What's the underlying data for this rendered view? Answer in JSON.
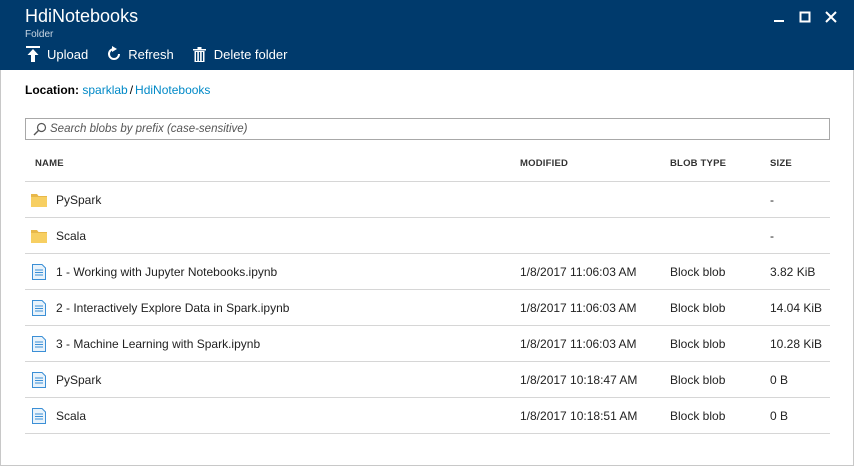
{
  "header": {
    "title": "HdiNotebooks",
    "subtitle": "Folder",
    "bg_color": "#003a6c"
  },
  "window_controls": [
    {
      "name": "minimize-icon"
    },
    {
      "name": "maximize-icon"
    },
    {
      "name": "close-icon"
    }
  ],
  "toolbar": {
    "upload_label": "Upload",
    "refresh_label": "Refresh",
    "delete_label": "Delete folder"
  },
  "location": {
    "label": "Location:",
    "path": [
      "sparklab",
      "HdiNotebooks"
    ],
    "separator": "/",
    "link_color": "#0089c7"
  },
  "search": {
    "placeholder": "Search blobs by prefix (case-sensitive)",
    "value": ""
  },
  "table": {
    "columns": [
      "NAME",
      "MODIFIED",
      "BLOB TYPE",
      "SIZE"
    ],
    "rows": [
      {
        "icon": "folder-icon",
        "name": "PySpark",
        "modified": "",
        "type": "",
        "size": "-"
      },
      {
        "icon": "folder-icon",
        "name": "Scala",
        "modified": "",
        "type": "",
        "size": "-"
      },
      {
        "icon": "file-icon",
        "name": "1 - Working with Jupyter Notebooks.ipynb",
        "modified": "1/8/2017 11:06:03 AM",
        "type": "Block blob",
        "size": "3.82 KiB"
      },
      {
        "icon": "file-icon",
        "name": "2 - Interactively Explore Data in Spark.ipynb",
        "modified": "1/8/2017 11:06:03 AM",
        "type": "Block blob",
        "size": "14.04 KiB"
      },
      {
        "icon": "file-icon",
        "name": "3 - Machine Learning with Spark.ipynb",
        "modified": "1/8/2017 11:06:03 AM",
        "type": "Block blob",
        "size": "10.28 KiB"
      },
      {
        "icon": "file-icon",
        "name": "PySpark",
        "modified": "1/8/2017 10:18:47 AM",
        "type": "Block blob",
        "size": "0 B"
      },
      {
        "icon": "file-icon",
        "name": "Scala",
        "modified": "1/8/2017 10:18:51 AM",
        "type": "Block blob",
        "size": "0 B"
      }
    ]
  }
}
